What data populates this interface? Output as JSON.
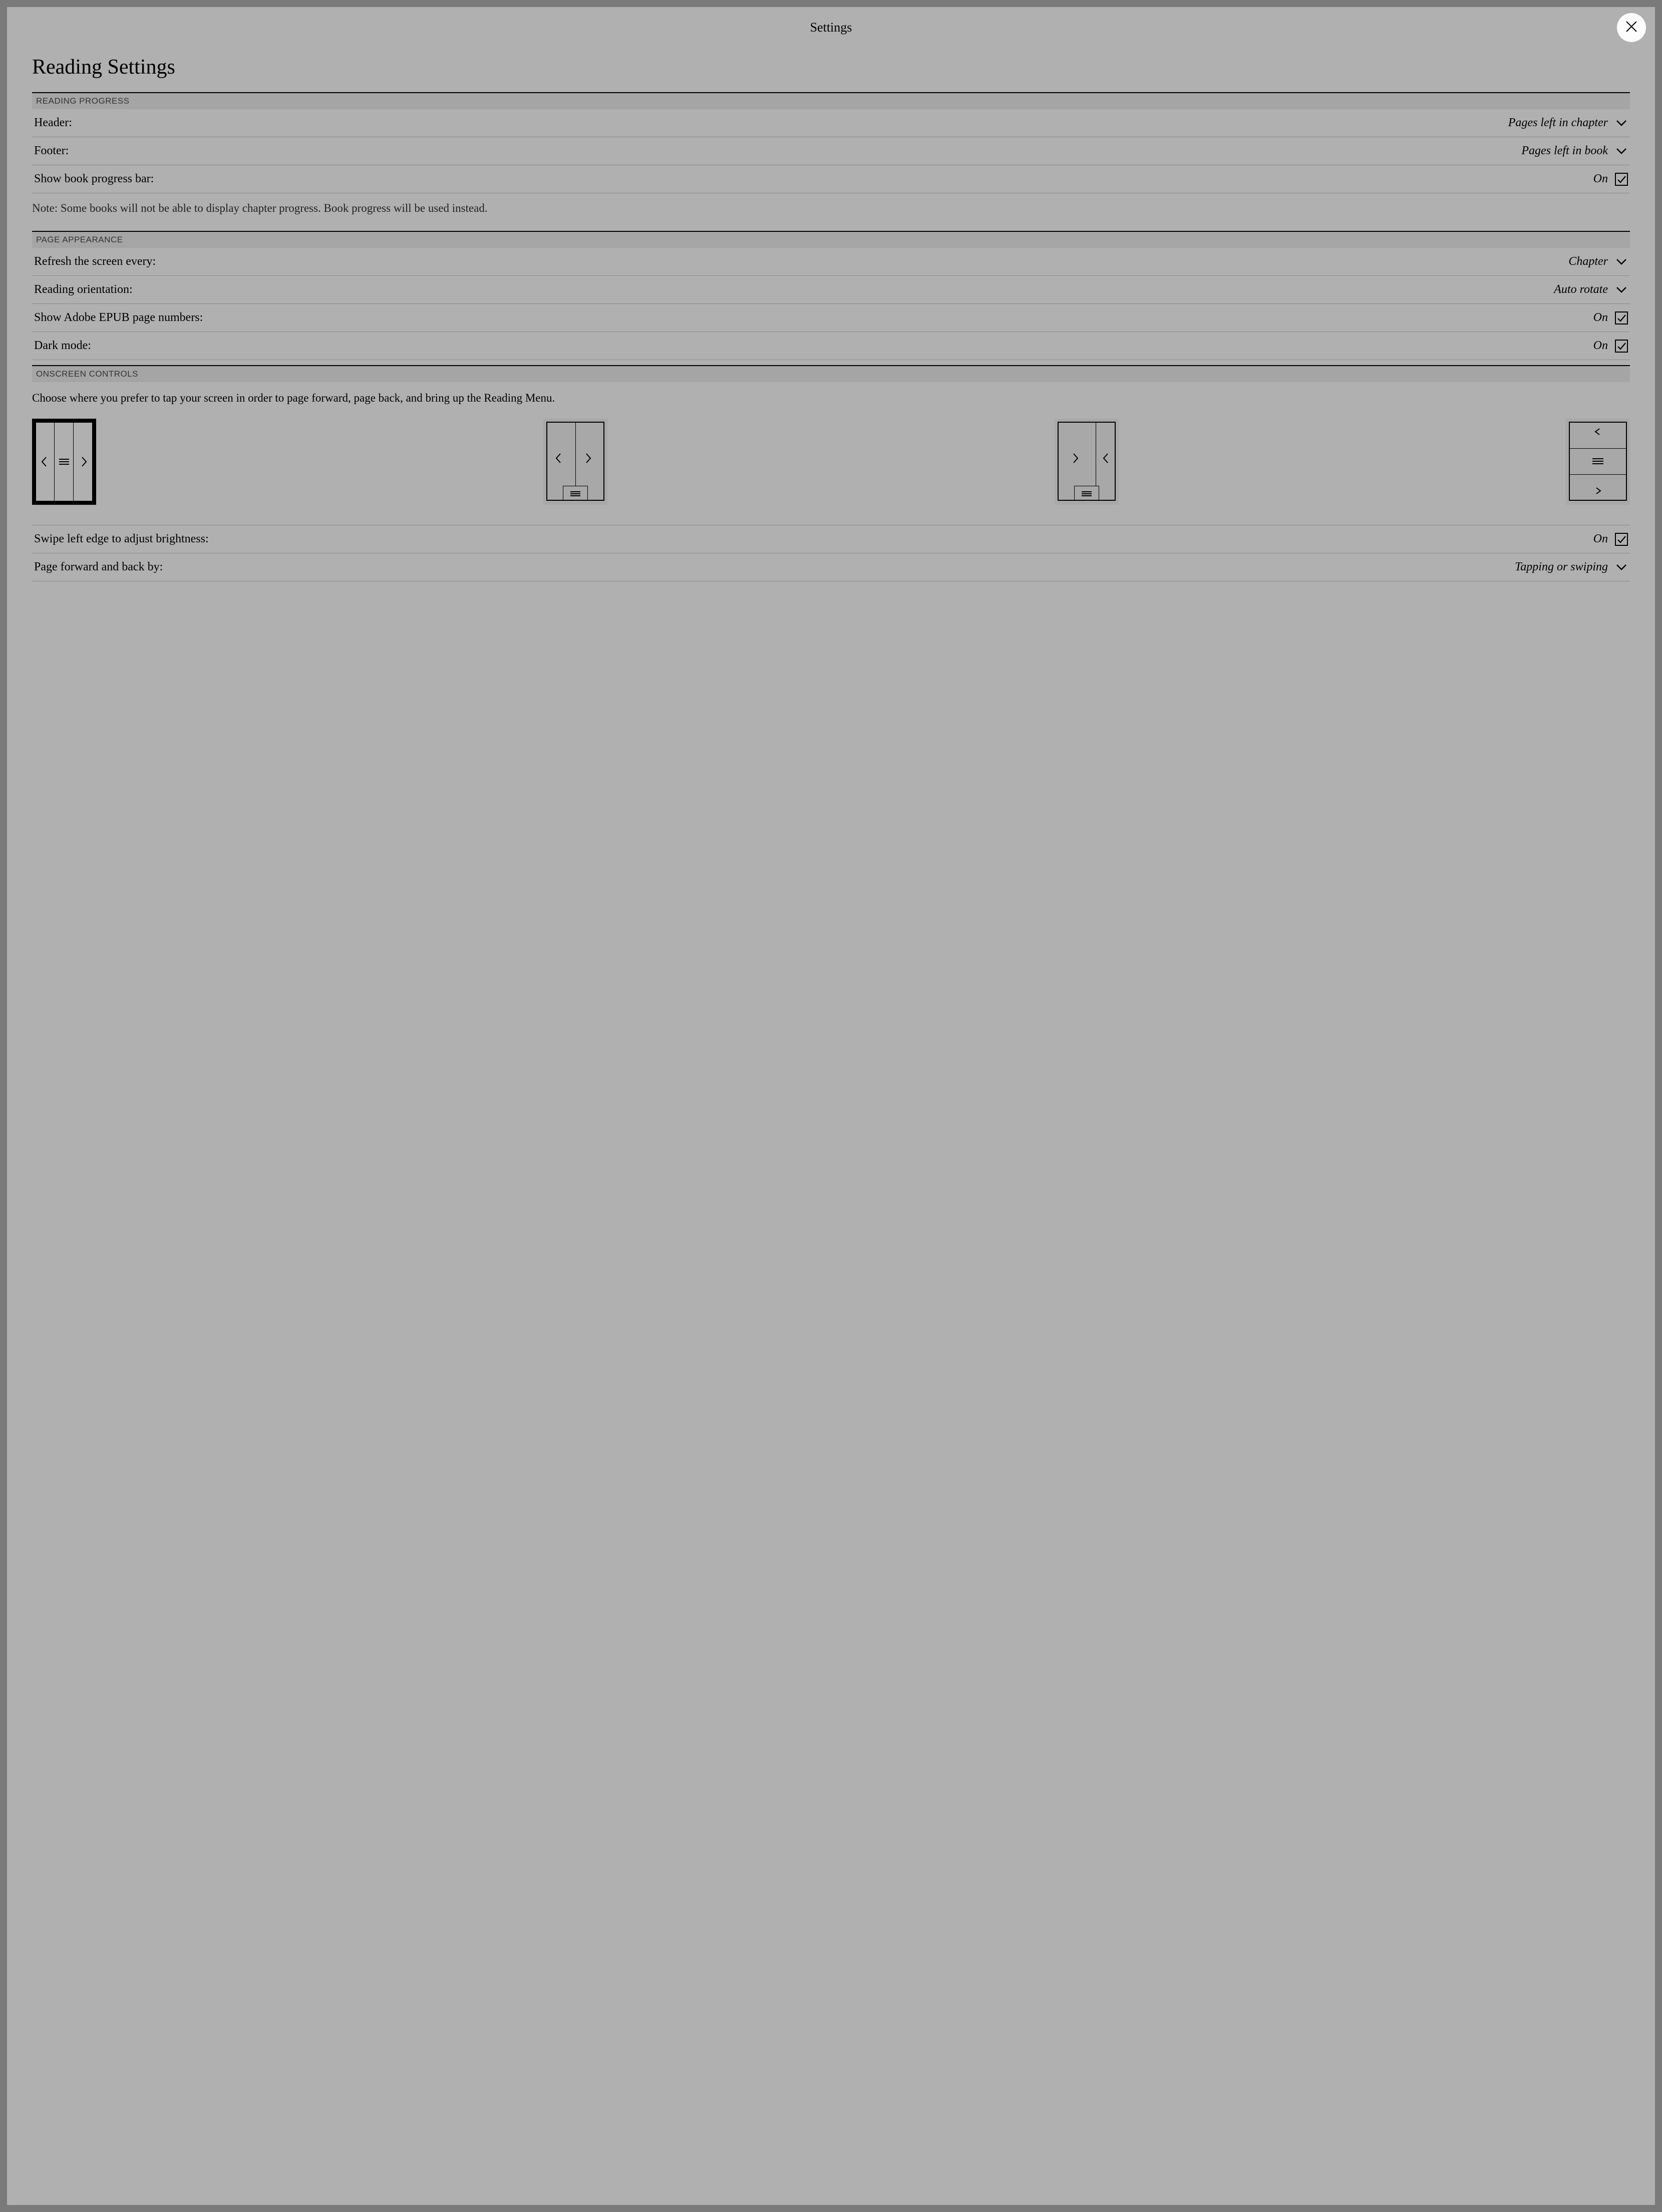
{
  "topbar": {
    "title": "Settings"
  },
  "page": {
    "title": "Reading Settings"
  },
  "sections": {
    "progress": {
      "header": "READING PROGRESS",
      "header_row": {
        "label": "Header:",
        "value": "Pages left in chapter"
      },
      "footer_row": {
        "label": "Footer:",
        "value": "Pages left in book"
      },
      "progressbar_row": {
        "label": "Show book progress bar:",
        "value": "On"
      },
      "note": "Note: Some books will not be able to display chapter progress. Book progress will be used instead."
    },
    "appearance": {
      "header": "PAGE APPEARANCE",
      "refresh_row": {
        "label": "Refresh the screen every:",
        "value": "Chapter"
      },
      "orientation_row": {
        "label": "Reading orientation:",
        "value": "Auto rotate"
      },
      "adobe_row": {
        "label": "Show Adobe EPUB page numbers:",
        "value": "On"
      },
      "darkmode_row": {
        "label": "Dark mode:",
        "value": "On"
      }
    },
    "controls": {
      "header": "ONSCREEN CONTROLS",
      "desc": "Choose where you prefer to tap your screen in order to page forward, page back, and bring up the Reading Menu.",
      "swipe_row": {
        "label": "Swipe left edge to adjust brightness:",
        "value": "On"
      },
      "paging_row": {
        "label": "Page forward and back by:",
        "value": "Tapping or swiping"
      }
    }
  }
}
